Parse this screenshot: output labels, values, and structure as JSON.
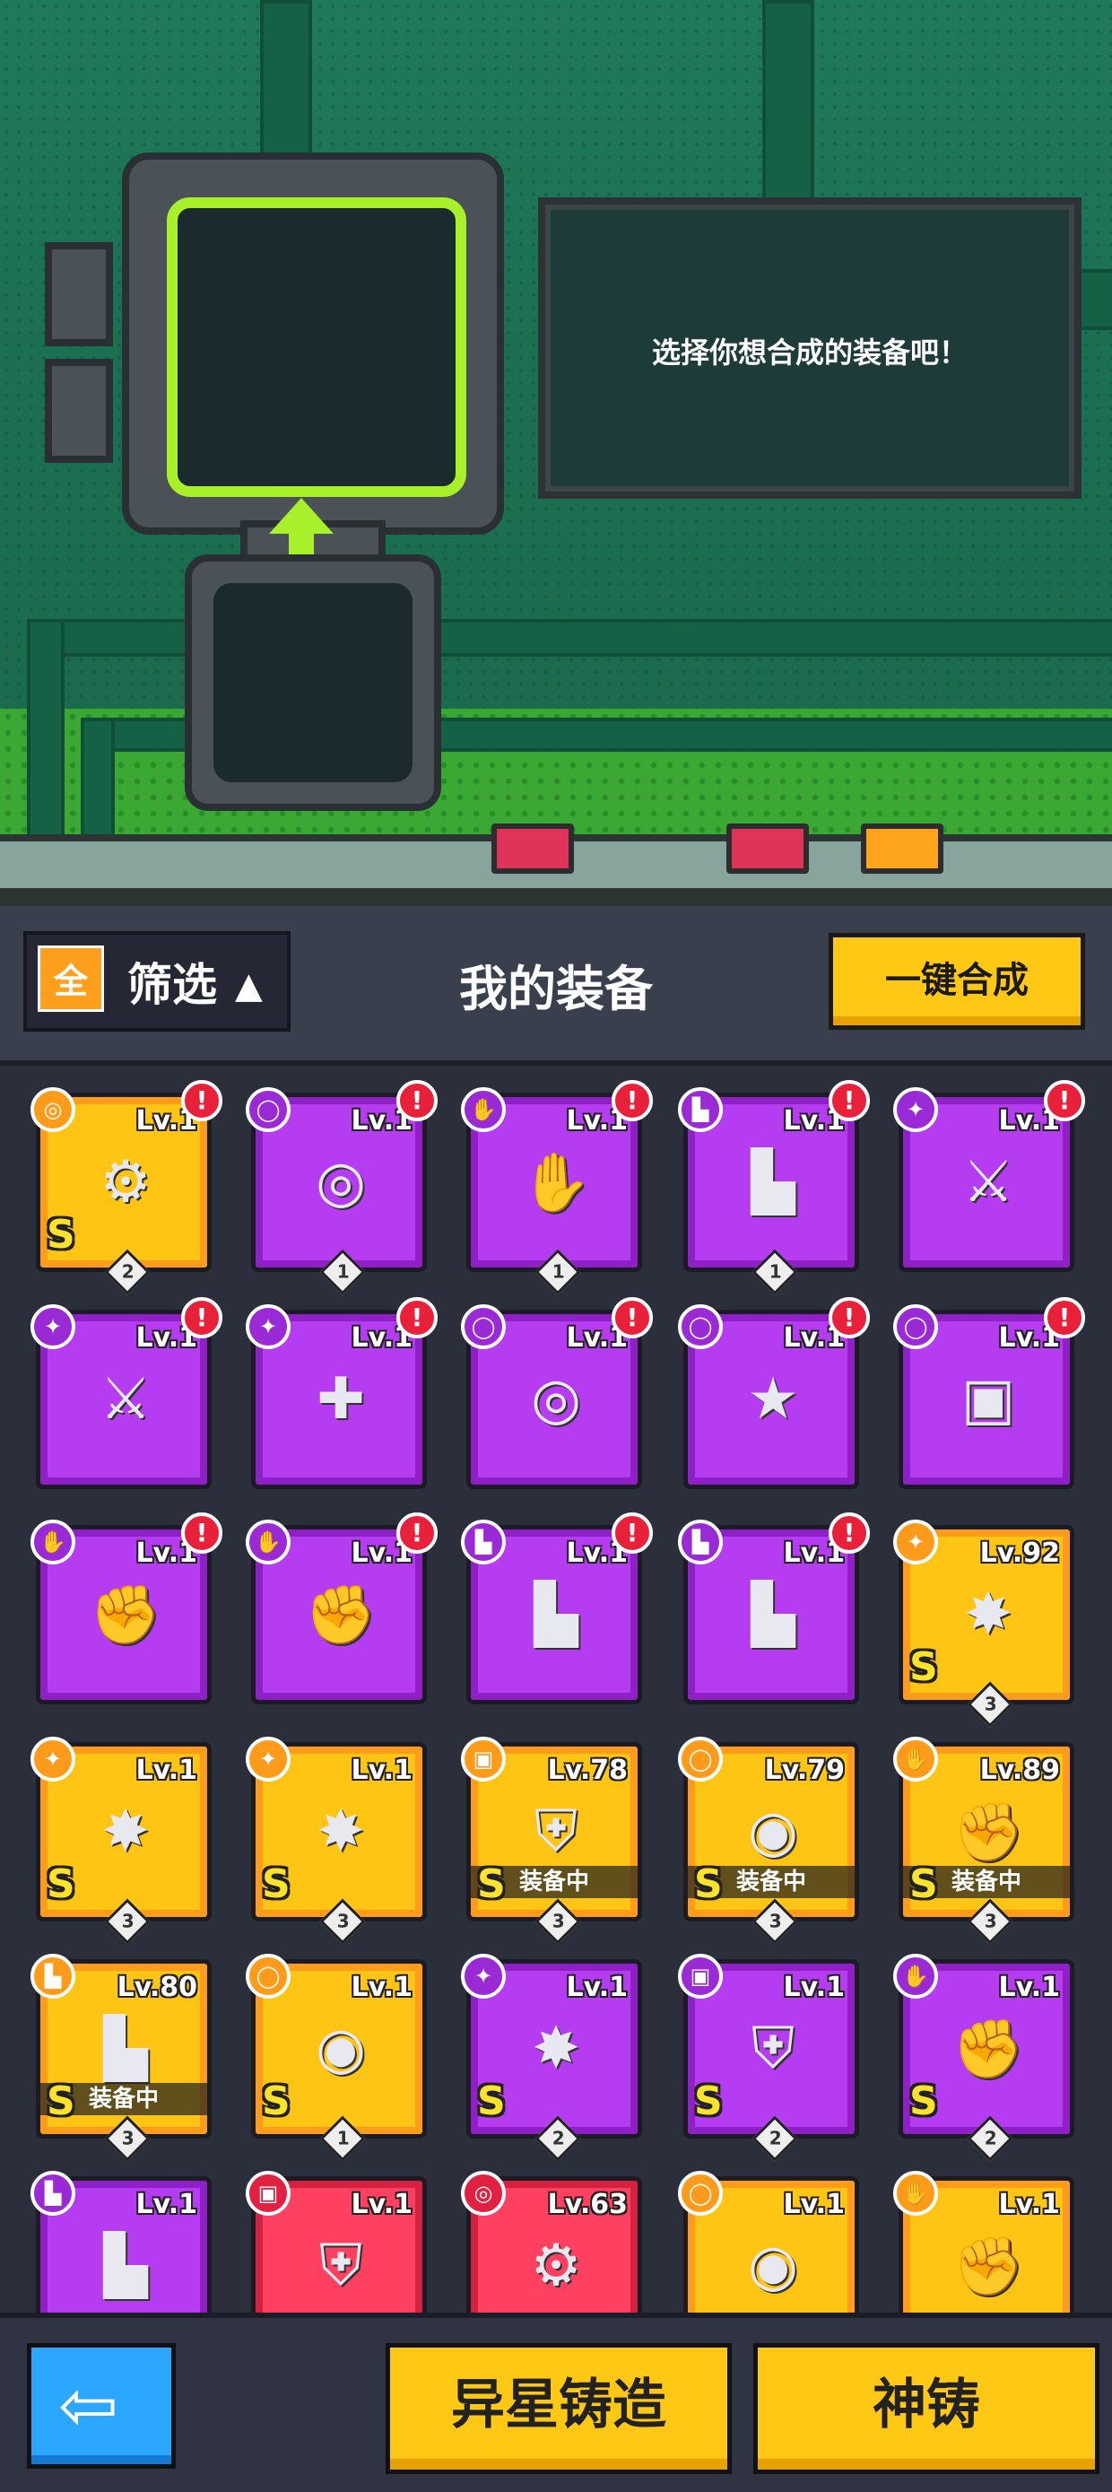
{
  "scene": {
    "prompt_text": "选择你想合成的装备吧！"
  },
  "header": {
    "filter_icon": "全",
    "filter_label": "筛选",
    "filter_arrow": "▲",
    "title": "我的装备",
    "merge_button": "一键合成"
  },
  "items": [
    {
      "tier": "gold",
      "slot": "necklace-icon",
      "slot_glyph": "◎",
      "lv": "Lv.1",
      "alert": true,
      "grade": "S",
      "count": "2",
      "equipped": false,
      "art": "necklace"
    },
    {
      "tier": "purple",
      "slot": "belt-icon",
      "slot_glyph": "◯",
      "lv": "Lv.1",
      "alert": true,
      "grade": "",
      "count": "1",
      "equipped": false,
      "art": "belt"
    },
    {
      "tier": "purple",
      "slot": "glove-icon",
      "slot_glyph": "✋",
      "lv": "Lv.1",
      "alert": true,
      "grade": "",
      "count": "1",
      "equipped": false,
      "art": "glove"
    },
    {
      "tier": "purple",
      "slot": "boot-icon",
      "slot_glyph": "▙",
      "lv": "Lv.1",
      "alert": true,
      "grade": "",
      "count": "1",
      "equipped": false,
      "art": "boot"
    },
    {
      "tier": "purple",
      "slot": "weapon-icon",
      "slot_glyph": "✦",
      "lv": "Lv.1",
      "alert": true,
      "grade": "",
      "count": "",
      "equipped": false,
      "art": "sword"
    },
    {
      "tier": "purple",
      "slot": "weapon-icon",
      "slot_glyph": "✦",
      "lv": "Lv.1",
      "alert": true,
      "grade": "",
      "count": "",
      "equipped": false,
      "art": "sword"
    },
    {
      "tier": "purple",
      "slot": "weapon-icon",
      "slot_glyph": "✦",
      "lv": "Lv.1",
      "alert": true,
      "grade": "",
      "count": "",
      "equipped": false,
      "art": "revolver"
    },
    {
      "tier": "purple",
      "slot": "belt-icon",
      "slot_glyph": "◯",
      "lv": "Lv.1",
      "alert": true,
      "grade": "",
      "count": "",
      "equipped": false,
      "art": "belt"
    },
    {
      "tier": "purple",
      "slot": "belt-icon",
      "slot_glyph": "◯",
      "lv": "Lv.1",
      "alert": true,
      "grade": "",
      "count": "",
      "equipped": false,
      "art": "belt-star"
    },
    {
      "tier": "purple",
      "slot": "belt-icon",
      "slot_glyph": "◯",
      "lv": "Lv.1",
      "alert": true,
      "grade": "",
      "count": "",
      "equipped": false,
      "art": "belt-buckle"
    },
    {
      "tier": "purple",
      "slot": "glove-icon",
      "slot_glyph": "✋",
      "lv": "Lv.1",
      "alert": true,
      "grade": "",
      "count": "",
      "equipped": false,
      "art": "gauntlet"
    },
    {
      "tier": "purple",
      "slot": "glove-icon",
      "slot_glyph": "✋",
      "lv": "Lv.1",
      "alert": true,
      "grade": "",
      "count": "",
      "equipped": false,
      "art": "gauntlet"
    },
    {
      "tier": "purple",
      "slot": "boot-icon",
      "slot_glyph": "▙",
      "lv": "Lv.1",
      "alert": true,
      "grade": "",
      "count": "",
      "equipped": false,
      "art": "boot"
    },
    {
      "tier": "purple",
      "slot": "boot-icon",
      "slot_glyph": "▙",
      "lv": "Lv.1",
      "alert": true,
      "grade": "",
      "count": "",
      "equipped": false,
      "art": "boot"
    },
    {
      "tier": "gold",
      "slot": "weapon-icon",
      "slot_glyph": "✦",
      "lv": "Lv.92",
      "alert": false,
      "grade": "S",
      "count": "3",
      "equipped": false,
      "art": "blade"
    },
    {
      "tier": "gold",
      "slot": "weapon-icon",
      "slot_glyph": "✦",
      "lv": "Lv.1",
      "alert": false,
      "grade": "S",
      "count": "3",
      "equipped": false,
      "art": "blade"
    },
    {
      "tier": "gold",
      "slot": "weapon-icon",
      "slot_glyph": "✦",
      "lv": "Lv.1",
      "alert": false,
      "grade": "S",
      "count": "3",
      "equipped": false,
      "art": "blade"
    },
    {
      "tier": "gold",
      "slot": "armor-icon",
      "slot_glyph": "▣",
      "lv": "Lv.78",
      "alert": false,
      "grade": "S",
      "count": "3",
      "equipped": true,
      "art": "armor"
    },
    {
      "tier": "gold",
      "slot": "belt-icon",
      "slot_glyph": "◯",
      "lv": "Lv.79",
      "alert": false,
      "grade": "S",
      "count": "3",
      "equipped": true,
      "art": "belt-orb"
    },
    {
      "tier": "gold",
      "slot": "glove-icon",
      "slot_glyph": "✋",
      "lv": "Lv.89",
      "alert": false,
      "grade": "S",
      "count": "3",
      "equipped": true,
      "art": "gauntlet"
    },
    {
      "tier": "gold",
      "slot": "boot-icon",
      "slot_glyph": "▙",
      "lv": "Lv.80",
      "alert": false,
      "grade": "S",
      "count": "3",
      "equipped": true,
      "art": "boot"
    },
    {
      "tier": "gold",
      "slot": "belt-icon",
      "slot_glyph": "◯",
      "lv": "Lv.1",
      "alert": false,
      "grade": "S",
      "count": "1",
      "equipped": false,
      "art": "belt-orb"
    },
    {
      "tier": "purple",
      "slot": "weapon-icon",
      "slot_glyph": "✦",
      "lv": "Lv.1",
      "alert": false,
      "grade": "S",
      "count": "2",
      "equipped": false,
      "art": "blade"
    },
    {
      "tier": "purple",
      "slot": "armor-icon",
      "slot_glyph": "▣",
      "lv": "Lv.1",
      "alert": false,
      "grade": "S",
      "count": "2",
      "equipped": false,
      "art": "armor"
    },
    {
      "tier": "purple",
      "slot": "glove-icon",
      "slot_glyph": "✋",
      "lv": "Lv.1",
      "alert": false,
      "grade": "S",
      "count": "2",
      "equipped": false,
      "art": "gauntlet"
    },
    {
      "tier": "purple",
      "slot": "boot-icon",
      "slot_glyph": "▙",
      "lv": "Lv.1",
      "alert": false,
      "grade": "",
      "count": "",
      "equipped": false,
      "art": "boot"
    },
    {
      "tier": "red",
      "slot": "armor-icon",
      "slot_glyph": "▣",
      "lv": "Lv.1",
      "alert": false,
      "grade": "",
      "count": "",
      "equipped": false,
      "art": "armor"
    },
    {
      "tier": "red",
      "slot": "necklace-icon",
      "slot_glyph": "◎",
      "lv": "Lv.63",
      "alert": false,
      "grade": "",
      "count": "",
      "equipped": false,
      "art": "necklace"
    },
    {
      "tier": "gold",
      "slot": "belt-icon",
      "slot_glyph": "◯",
      "lv": "Lv.1",
      "alert": false,
      "grade": "",
      "count": "",
      "equipped": false,
      "art": "belt-orb"
    },
    {
      "tier": "gold",
      "slot": "glove-icon",
      "slot_glyph": "✋",
      "lv": "Lv.1",
      "alert": false,
      "grade": "",
      "count": "",
      "equipped": false,
      "art": "gauntlet"
    }
  ],
  "labels": {
    "equipped_text": "装备中",
    "alert_glyph": "!"
  },
  "footer": {
    "back_arrow": "⇦",
    "forge_button": "异星铸造",
    "divine_button": "神铸"
  }
}
